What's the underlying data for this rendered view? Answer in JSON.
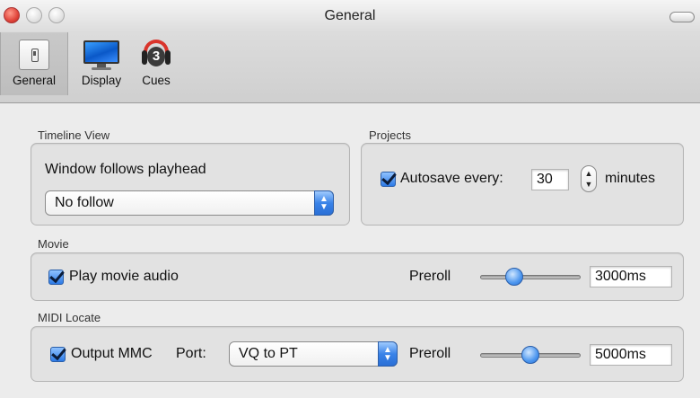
{
  "window": {
    "title": "General"
  },
  "toolbar": {
    "items": [
      {
        "label": "General",
        "icon": "switch-icon",
        "selected": true
      },
      {
        "label": "Display",
        "icon": "monitor-icon",
        "selected": false
      },
      {
        "label": "Cues",
        "icon": "headphones-icon",
        "selected": false
      }
    ]
  },
  "timeline_view": {
    "group_label": "Timeline View",
    "heading": "Window follows playhead",
    "follow_select": "No follow"
  },
  "projects": {
    "group_label": "Projects",
    "autosave_label": "Autosave every:",
    "autosave_checked": true,
    "autosave_value": "30",
    "unit": "minutes"
  },
  "movie": {
    "group_label": "Movie",
    "play_audio_label": "Play movie audio",
    "play_audio_checked": true,
    "preroll_label": "Preroll",
    "preroll_value": "3000ms",
    "preroll_slider_fraction": 0.3
  },
  "midi_locate": {
    "group_label": "MIDI Locate",
    "output_mmc_label": "Output MMC",
    "output_mmc_checked": true,
    "port_label": "Port:",
    "port_select": "VQ to PT",
    "preroll_label": "Preroll",
    "preroll_value": "5000ms",
    "preroll_slider_fraction": 0.5
  }
}
